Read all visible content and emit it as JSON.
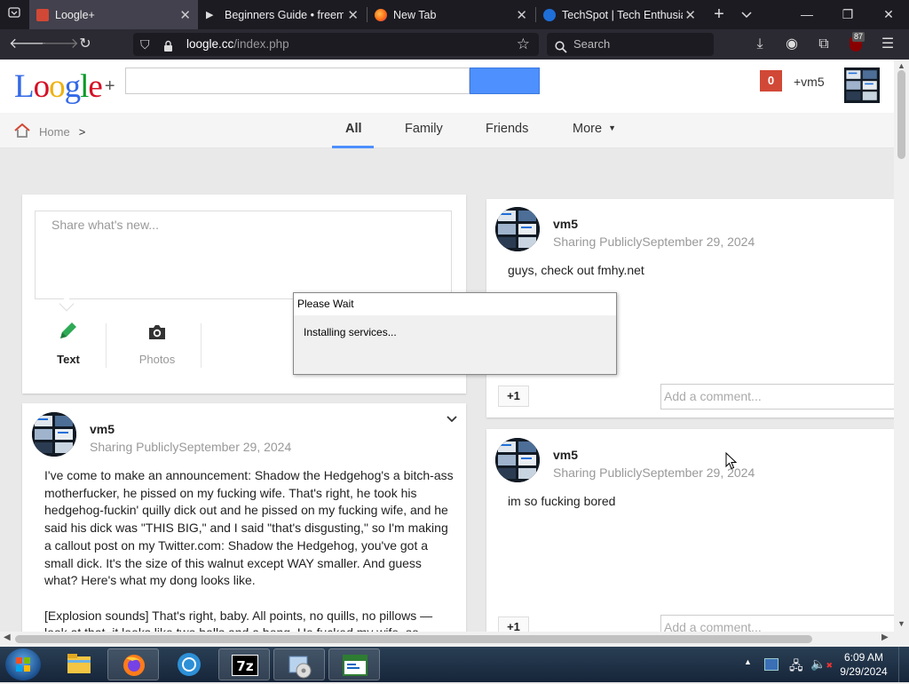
{
  "browser": {
    "tabs": [
      {
        "title": "Loogle+",
        "active": true
      },
      {
        "title": "Beginners Guide • freemedi"
      },
      {
        "title": "New Tab"
      },
      {
        "title": "TechSpot | Tech Enthusias"
      }
    ],
    "url_host": "loogle.cc",
    "url_path": "/index.php",
    "search_placeholder": "Search",
    "extension_badge": "87"
  },
  "site": {
    "logo": "Loogle",
    "logo_plus": "+",
    "search_value": "",
    "notification_count": "0",
    "user_link": "+vm5",
    "breadcrumb_home": "Home",
    "breadcrumb_sep": ">",
    "nav_tabs": [
      "All",
      "Family",
      "Friends",
      "More"
    ],
    "active_tab": "All"
  },
  "composer": {
    "placeholder": "Share what's new...",
    "text_label": "Text",
    "photos_label": "Photos"
  },
  "posts": [
    {
      "author": "vm5",
      "visibility": "Sharing Publicly",
      "date": "September 29, 2024",
      "body_paragraphs": [
        "I've come to make an announcement: Shadow the Hedgehog's a bitch-ass motherfucker, he pissed on my fucking wife. That's right, he took his hedgehog-fuckin' quilly dick out and he pissed on my fucking wife, and he said his dick was \"THIS BIG,\" and I said \"that's disgusting,\" so I'm making a callout post on my Twitter.com: Shadow the Hedgehog, you've got a small dick. It's the size of this walnut except WAY smaller. And guess what? Here's what my dong looks like.",
        "[Explosion sounds] That's right, baby. All points, no quills, no pillows — look at that, it looks like two balls and a bong. He fucked my wife, so"
      ]
    },
    {
      "author": "vm5",
      "visibility": "Sharing Publicly",
      "date": "September 29, 2024",
      "body": "guys, check out fmhy.net"
    },
    {
      "author": "vm5",
      "visibility": "Sharing Publicly",
      "date": "September 29, 2024",
      "body": "im so fucking bored"
    }
  ],
  "post_actions": {
    "plus_one": "+1",
    "comment_placeholder": "Add a comment..."
  },
  "dialog": {
    "title": "Please Wait",
    "message": "Installing services..."
  },
  "taskbar": {
    "time": "6:09 AM",
    "date": "9/29/2024"
  },
  "colors": {
    "logo_L": "#3369e8",
    "logo_o1": "#d50f25",
    "logo_o2": "#eeb211",
    "logo_g": "#3369e8",
    "logo_l": "#009925",
    "logo_e": "#d50f25",
    "accent": "#4d90fe",
    "notification": "#d14836"
  },
  "icons": [
    "tab-list-icon",
    "back-icon",
    "forward-icon",
    "reload-icon",
    "shield-icon",
    "lock-icon",
    "bookmark-star-icon",
    "search-icon",
    "download-icon",
    "account-icon",
    "extensions-icon",
    "menu-icon",
    "home-icon",
    "pencil-icon",
    "camera-icon",
    "chevron-down-icon"
  ]
}
